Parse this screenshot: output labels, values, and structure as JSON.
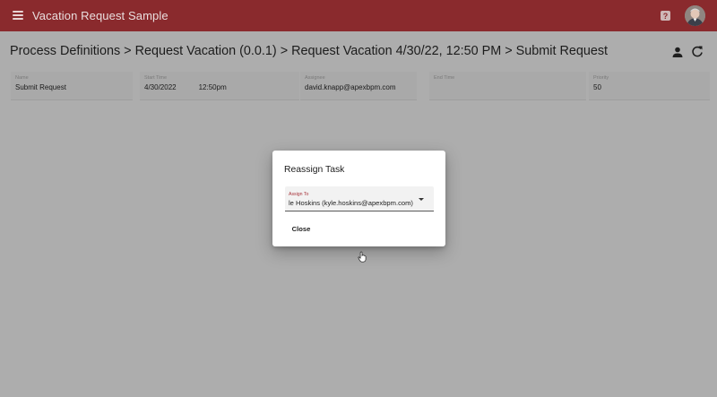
{
  "app": {
    "title": "Vacation Request Sample",
    "help_glyph": "?",
    "icons": {
      "menu": "hamburger-menu-icon",
      "help": "help-icon",
      "avatar": "user-avatar"
    },
    "colors": {
      "appbar": "#8a2a2d",
      "overlay": "#adadad",
      "accent": "#a8343b"
    }
  },
  "breadcrumb": {
    "items": [
      "Process Definitions",
      "Request Vacation (0.0.1)",
      "Request Vacation 4/30/22, 12:50 PM",
      "Submit Request"
    ],
    "separator": ">"
  },
  "toolbar": {
    "icons": [
      "person-icon",
      "refresh-icon"
    ]
  },
  "fields": {
    "name": {
      "label": "Name",
      "value": "Submit Request"
    },
    "start_time": {
      "label": "Start Time",
      "date": "4/30/2022",
      "time": "12:50pm"
    },
    "assignee": {
      "label": "Assignee",
      "value": "david.knapp@apexbpm.com"
    },
    "end_time": {
      "label": "End Time",
      "value": ""
    },
    "priority": {
      "label": "Priority",
      "value": "50"
    }
  },
  "dialog": {
    "title": "Reassign Task",
    "assign_to": {
      "label": "Assign To",
      "value": "le Hoskins (kyle.hoskins@apexbpm.com)"
    },
    "close_label": "Close"
  }
}
